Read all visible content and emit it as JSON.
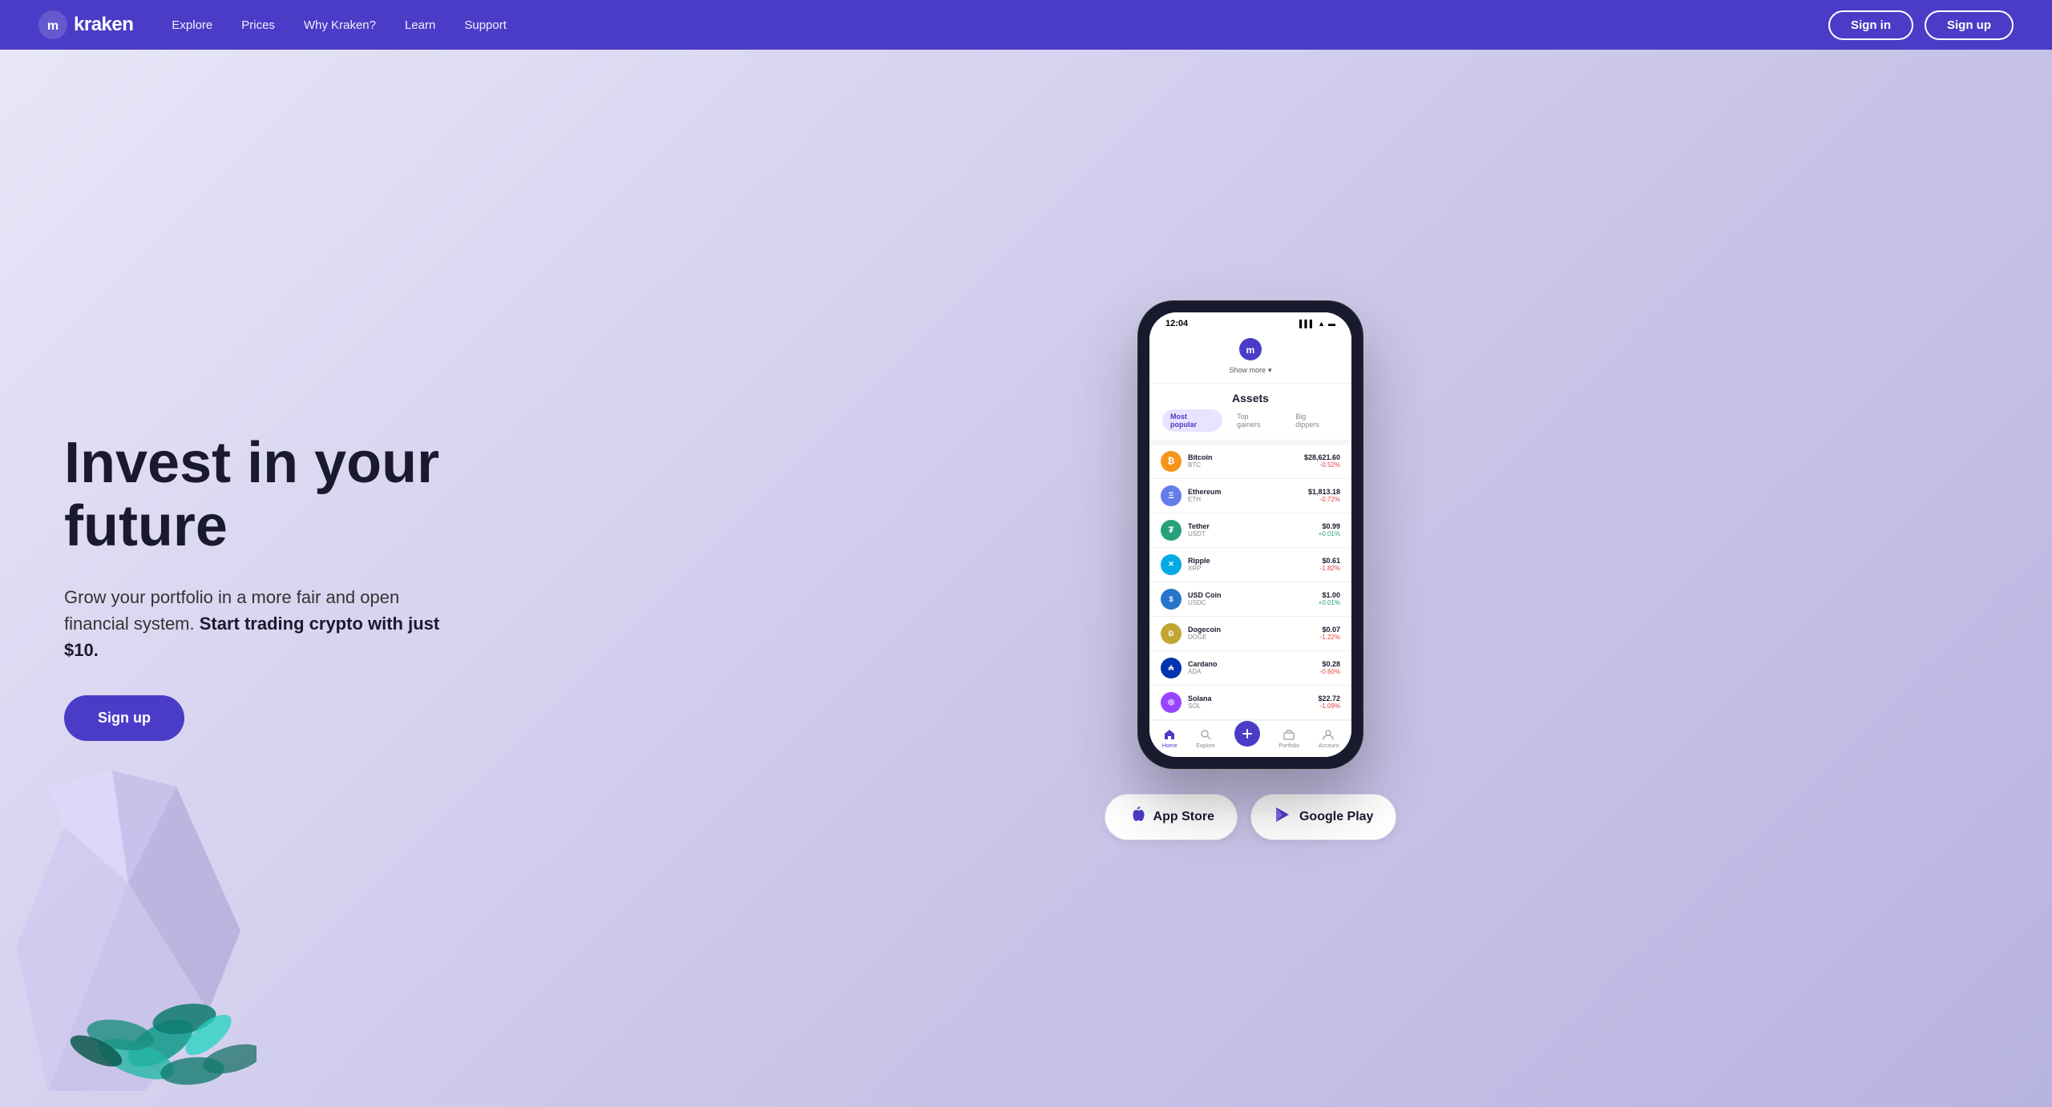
{
  "nav": {
    "logo_text": "kraken",
    "links": [
      {
        "label": "Explore",
        "id": "explore"
      },
      {
        "label": "Prices",
        "id": "prices"
      },
      {
        "label": "Why Kraken?",
        "id": "why-kraken"
      },
      {
        "label": "Learn",
        "id": "learn"
      },
      {
        "label": "Support",
        "id": "support"
      }
    ],
    "signin_label": "Sign in",
    "signup_label": "Sign up"
  },
  "hero": {
    "title_line1": "Invest in your",
    "title_line2": "future",
    "subtitle_plain": "Grow your portfolio in a more fair and open financial system.",
    "subtitle_bold": "Start trading crypto with just $10.",
    "cta_label": "Sign up"
  },
  "phone": {
    "status_time": "12:04",
    "show_more": "Show more",
    "assets_title": "Assets",
    "tabs": [
      {
        "label": "Most popular",
        "active": true
      },
      {
        "label": "Top gainers",
        "active": false
      },
      {
        "label": "Big dippers",
        "active": false
      }
    ],
    "assets": [
      {
        "name": "Bitcoin",
        "symbol": "BTC",
        "price": "$28,621.60",
        "change": "-0.52%",
        "positive": false,
        "icon_class": "btc",
        "icon_letter": "₿"
      },
      {
        "name": "Ethereum",
        "symbol": "ETH",
        "price": "$1,813.18",
        "change": "-0.72%",
        "positive": false,
        "icon_class": "eth",
        "icon_letter": "Ξ"
      },
      {
        "name": "Tether",
        "symbol": "USDT",
        "price": "$0.99",
        "change": "+0.01%",
        "positive": true,
        "icon_class": "usdt",
        "icon_letter": "₮"
      },
      {
        "name": "Ripple",
        "symbol": "XRP",
        "price": "$0.61",
        "change": "-1.82%",
        "positive": false,
        "icon_class": "xrp",
        "icon_letter": "✕"
      },
      {
        "name": "USD Coin",
        "symbol": "USDC",
        "price": "$1.00",
        "change": "+0.01%",
        "positive": true,
        "icon_class": "usdc",
        "icon_letter": "◎"
      },
      {
        "name": "Dogecoin",
        "symbol": "DOGE",
        "price": "$0.07",
        "change": "-1.22%",
        "positive": false,
        "icon_class": "doge",
        "icon_letter": "Ð"
      },
      {
        "name": "Cardano",
        "symbol": "ADA",
        "price": "$0.28",
        "change": "-0.60%",
        "positive": false,
        "icon_class": "ada",
        "icon_letter": "₳"
      },
      {
        "name": "Solana",
        "symbol": "SOL",
        "price": "$22.72",
        "change": "-1.09%",
        "positive": false,
        "icon_class": "sol",
        "icon_letter": "◎"
      }
    ],
    "bottom_nav": [
      {
        "label": "Home",
        "active": true
      },
      {
        "label": "Explore",
        "active": false
      },
      {
        "label": "",
        "active": false,
        "center": true
      },
      {
        "label": "Portfolio",
        "active": false
      },
      {
        "label": "Account",
        "active": false
      }
    ]
  },
  "app_buttons": {
    "appstore_label": "App Store",
    "googleplay_label": "Google Play"
  }
}
